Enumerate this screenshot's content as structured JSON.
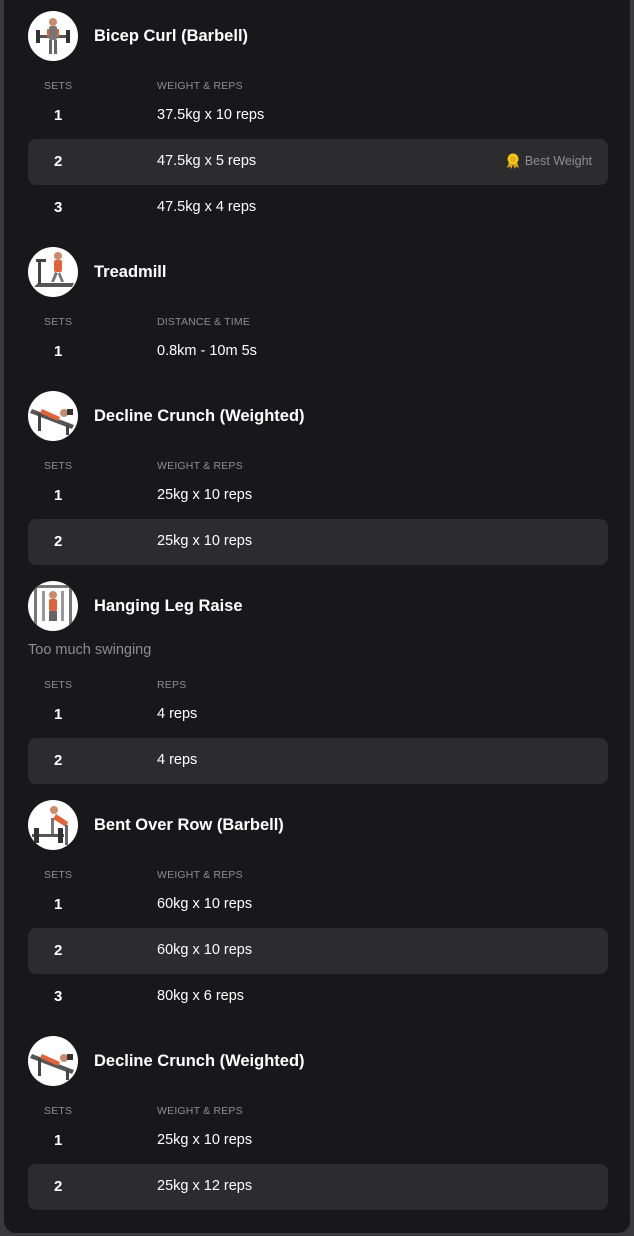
{
  "colors": {
    "background": "#18181a",
    "row_shade": "#2c2c2e",
    "muted_text": "#8e8e93",
    "medal": "#f5c518"
  },
  "exercises": [
    {
      "name": "Bicep Curl (Barbell)",
      "thumbnail_icon": "bicep-curl-icon",
      "sets_header": "SETS",
      "value_header": "WEIGHT & REPS",
      "sets": [
        {
          "num": "1",
          "value": "37.5kg x 10 reps"
        },
        {
          "num": "2",
          "value": "47.5kg x 5 reps",
          "record": "Best Weight",
          "record_icon": "medal-icon"
        },
        {
          "num": "3",
          "value": "47.5kg x 4 reps"
        }
      ]
    },
    {
      "name": "Treadmill",
      "thumbnail_icon": "treadmill-icon",
      "sets_header": "SETS",
      "value_header": "DISTANCE & TIME",
      "sets": [
        {
          "num": "1",
          "value": "0.8km - 10m 5s"
        }
      ]
    },
    {
      "name": "Decline Crunch (Weighted)",
      "thumbnail_icon": "decline-crunch-icon",
      "sets_header": "SETS",
      "value_header": "WEIGHT & REPS",
      "sets": [
        {
          "num": "1",
          "value": "25kg x 10 reps"
        },
        {
          "num": "2",
          "value": "25kg x 10 reps"
        }
      ]
    },
    {
      "name": "Hanging Leg Raise",
      "thumbnail_icon": "hanging-leg-raise-icon",
      "note": "Too much swinging",
      "sets_header": "SETS",
      "value_header": "REPS",
      "sets": [
        {
          "num": "1",
          "value": "4 reps"
        },
        {
          "num": "2",
          "value": "4 reps"
        }
      ]
    },
    {
      "name": "Bent Over Row (Barbell)",
      "thumbnail_icon": "bent-over-row-icon",
      "sets_header": "SETS",
      "value_header": "WEIGHT & REPS",
      "sets": [
        {
          "num": "1",
          "value": "60kg x 10 reps"
        },
        {
          "num": "2",
          "value": "60kg x 10 reps"
        },
        {
          "num": "3",
          "value": "80kg x 6 reps"
        }
      ]
    },
    {
      "name": "Decline Crunch (Weighted)",
      "thumbnail_icon": "decline-crunch-icon",
      "sets_header": "SETS",
      "value_header": "WEIGHT & REPS",
      "sets": [
        {
          "num": "1",
          "value": "25kg x 10 reps"
        },
        {
          "num": "2",
          "value": "25kg x 12 reps"
        }
      ]
    }
  ]
}
